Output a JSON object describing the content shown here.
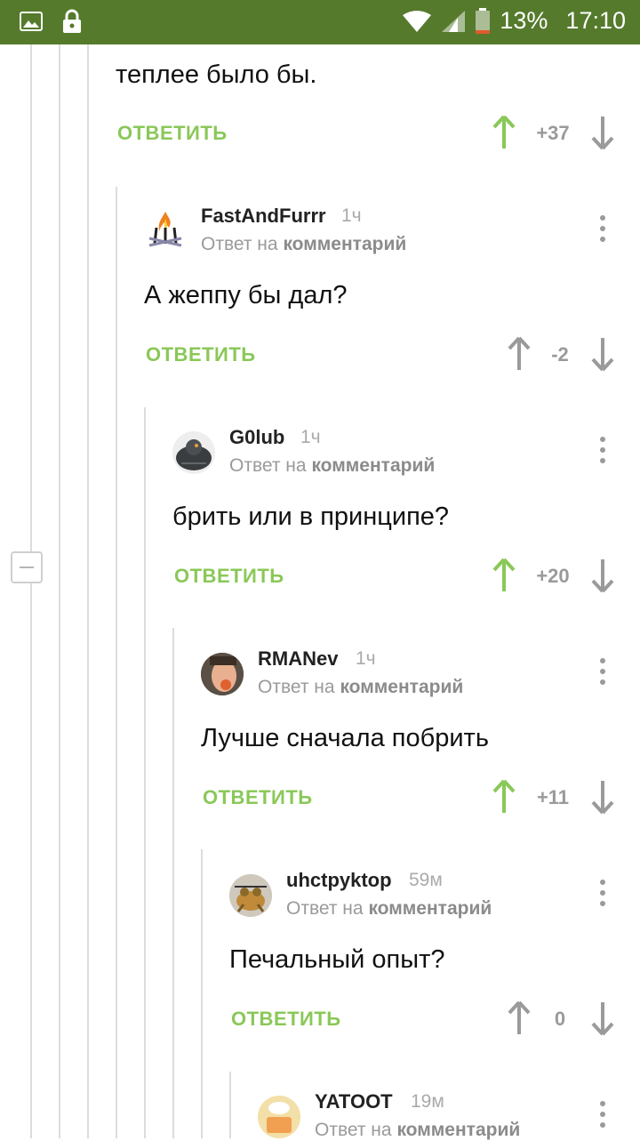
{
  "status_bar": {
    "battery": "13%",
    "time": "17:10"
  },
  "colors": {
    "status_bar": "#557a2c",
    "accent_green": "#8ac858",
    "gray": "#9a9a9a"
  },
  "first_comment": {
    "text": "теплее было бы.",
    "reply_label": "ОТВЕТИТЬ",
    "score": "+37",
    "vote": "up"
  },
  "comments": [
    {
      "author": "FastAndFurrr",
      "time": "1ч",
      "reply_to_prefix": "Ответ на",
      "reply_to_target": "комментарий",
      "text": "А жеппу бы дал?",
      "reply_label": "ОТВЕТИТЬ",
      "score": "-2",
      "vote": "none",
      "avatar": "campfire-avatar"
    },
    {
      "author": "G0lub",
      "time": "1ч",
      "reply_to_prefix": "Ответ на",
      "reply_to_target": "комментарий",
      "text": "брить или в принципе?",
      "reply_label": "ОТВЕТИТЬ",
      "score": "+20",
      "vote": "up",
      "avatar": "pigeon-avatar"
    },
    {
      "author": "RMANev",
      "time": "1ч",
      "reply_to_prefix": "Ответ на",
      "reply_to_target": "комментарий",
      "text": "Лучше сначала побрить",
      "reply_label": "ОТВЕТИТЬ",
      "score": "+11",
      "vote": "up",
      "avatar": "photo-avatar"
    },
    {
      "author": "uhctpyktop",
      "time": "59м",
      "reply_to_prefix": "Ответ на",
      "reply_to_target": "комментарий",
      "text": "Печальный опыт?",
      "reply_label": "ОТВЕТИТЬ",
      "score": "0",
      "vote": "none",
      "avatar": "frog-avatar"
    },
    {
      "author": "YATOOT",
      "time": "19м",
      "reply_to_prefix": "Ответ на",
      "reply_to_target": "комментарий",
      "avatar": "cake-avatar"
    }
  ]
}
